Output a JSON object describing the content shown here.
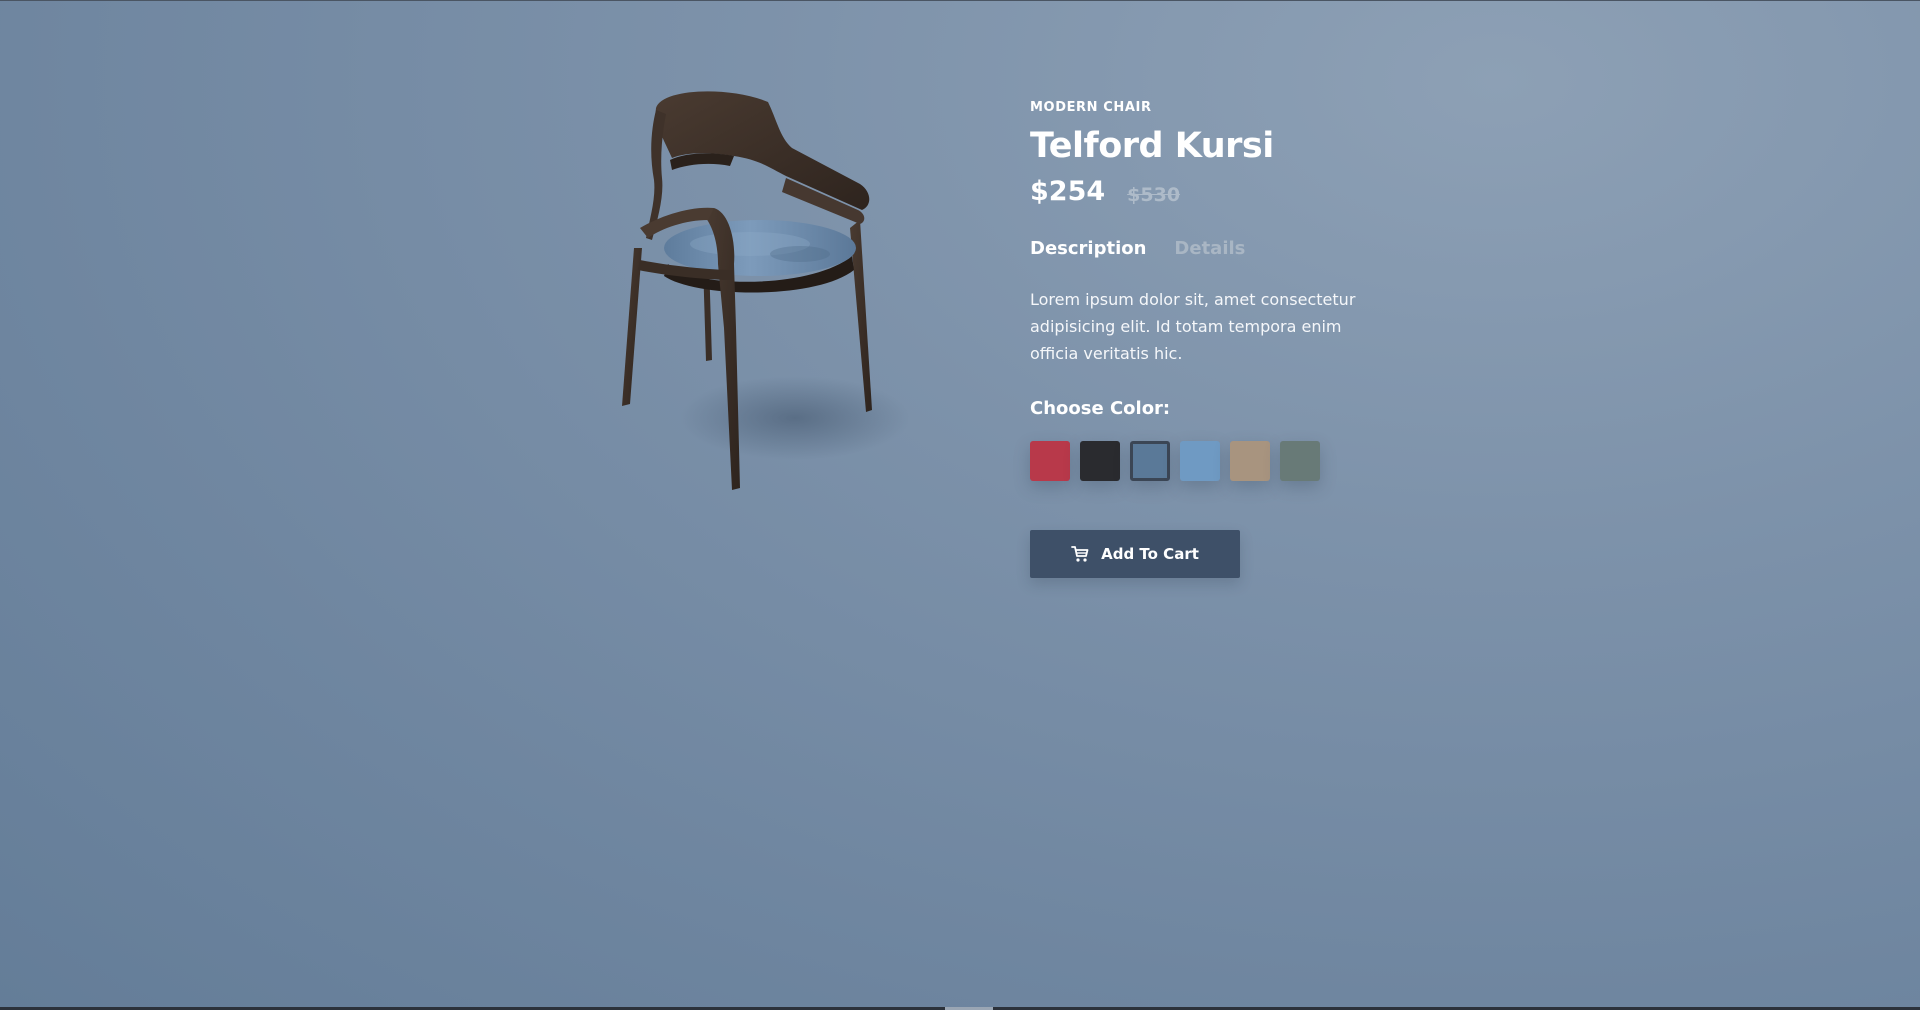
{
  "product": {
    "category": "MODERN CHAIR",
    "name": "Telford Kursi",
    "price": "$254",
    "old_price": "$530",
    "image_icon": "chair-image"
  },
  "tabs": [
    {
      "label": "Description",
      "active": true
    },
    {
      "label": "Details",
      "active": false
    }
  ],
  "description": "Lorem ipsum dolor sit, amet consectetur adipisicing elit. Id totam tempora enim officia veritatis hic.",
  "color_picker": {
    "label": "Choose Color:",
    "swatches": [
      {
        "name": "red",
        "color": "#b8394a",
        "selected": false
      },
      {
        "name": "black",
        "color": "#2a2b2f",
        "selected": false
      },
      {
        "name": "blue-velvet",
        "color": "#5a7998",
        "selected": true
      },
      {
        "name": "light-blue",
        "color": "#6f9ac3",
        "selected": false
      },
      {
        "name": "tan",
        "color": "#a8947f",
        "selected": false
      },
      {
        "name": "gray-green",
        "color": "#687a77",
        "selected": false
      }
    ]
  },
  "cart_button": {
    "label": "Add To Cart",
    "icon": "cart-icon"
  },
  "colors": {
    "background": "#7d92aa",
    "button": "#3e5068",
    "text": "#ffffff",
    "muted": "#a9b6c4"
  }
}
